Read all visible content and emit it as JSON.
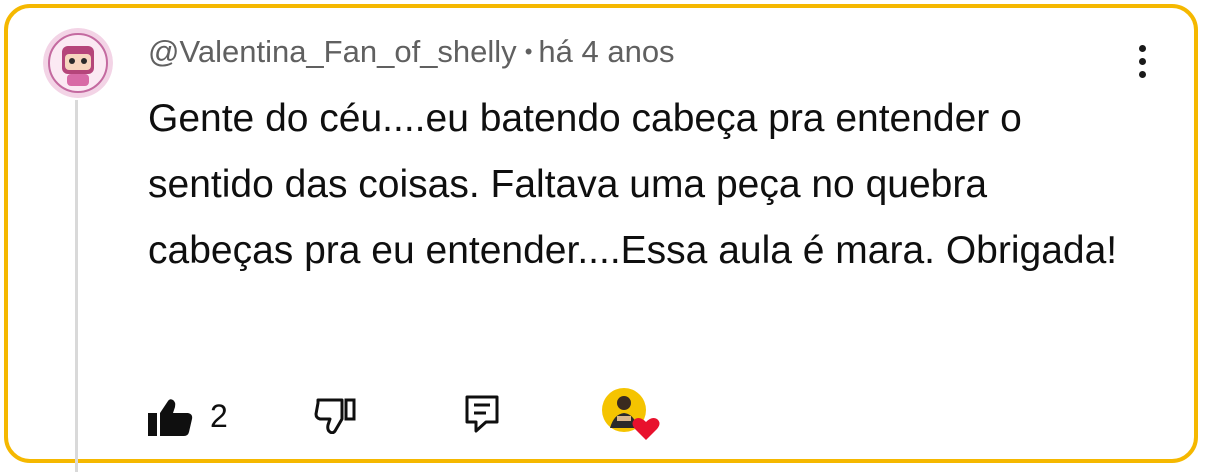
{
  "comment": {
    "author": "@Valentina_Fan_of_shelly",
    "separator": "•",
    "time": "há 4 anos",
    "text": "Gente do céu....eu batendo cabeça pra entender o sentido das coisas. Faltava uma peça no quebra cabeças pra eu entender....Essa aula é mara. Obrigada!",
    "like_count": "2"
  },
  "icons": {
    "avatar": "avatar-image",
    "menu": "more-vertical-icon",
    "like": "thumbs-up-filled-icon",
    "dislike": "thumbs-down-icon",
    "reply": "reply-comment-icon",
    "creator_heart": "creator-heart-icon"
  },
  "colors": {
    "border": "#F5B800",
    "meta_text": "#606060",
    "body_text": "#0f0f0f",
    "heart": "#E8112D"
  }
}
